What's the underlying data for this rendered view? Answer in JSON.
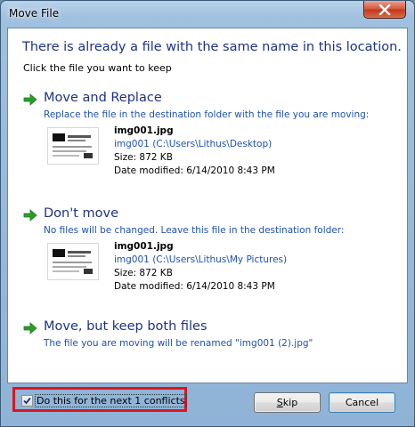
{
  "window": {
    "title": "Move File"
  },
  "dialog": {
    "heading": "There is already a file with the same name in this location.",
    "subheading": "Click the file you want to keep"
  },
  "options": [
    {
      "title": "Move and Replace",
      "description": "Replace the file in the destination folder with the file you are moving:",
      "file": {
        "name": "img001.jpg",
        "path": "img001 (C:\\Users\\Lithus\\Desktop)",
        "size": "Size: 872 KB",
        "date": "Date modified: 6/14/2010 8:43 PM"
      }
    },
    {
      "title": "Don't move",
      "description": "No files will be changed. Leave this file in the destination folder:",
      "file": {
        "name": "img001.jpg",
        "path": "img001 (C:\\Users\\Lithus\\My Pictures)",
        "size": "Size: 872 KB",
        "date": "Date modified: 6/14/2010 8:43 PM"
      }
    },
    {
      "title": "Move, but keep both files",
      "description": "The file you are moving will be renamed \"img001 (2).jpg\""
    }
  ],
  "footer": {
    "checkbox_label": "Do this for the next 1 conflicts",
    "checkbox_checked": true,
    "skip_label": "Skip",
    "cancel_label": "Cancel"
  },
  "colors": {
    "accent_blue": "#1e3287",
    "link_blue": "#1e50b4",
    "arrow_green": "#2a9d2a",
    "highlight_red": "#e0141c"
  }
}
